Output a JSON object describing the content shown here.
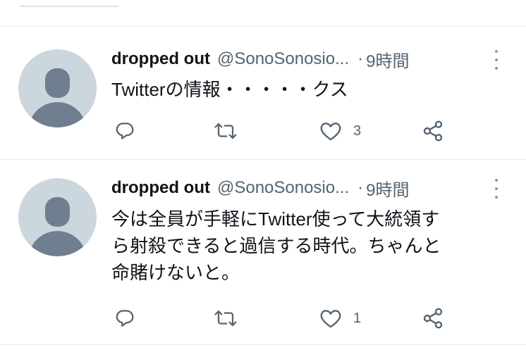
{
  "tweets": [
    {
      "name": "dropped out",
      "handle": "@SonoSonosio...",
      "separator": "·",
      "time": "9時間",
      "text": "Twitterの情報・・・・・クス",
      "like_count": "3"
    },
    {
      "name": "dropped out",
      "handle": "@SonoSonosio...",
      "separator": "·",
      "time": "9時間",
      "text_lines": [
        "今は全員が手軽にTwitter使って大統領す",
        "ら射殺できると過信する時代。ちゃんと",
        "命賭けないと。"
      ],
      "like_count": "1"
    }
  ],
  "icons": {
    "reply": "reply-icon",
    "retweet": "retweet-icon",
    "like": "heart-icon",
    "share": "share-icon",
    "more": "more-icon"
  },
  "colors": {
    "text": "#0f1419",
    "secondary": "#536471",
    "avatar_bg": "#ccd6dd",
    "avatar_fg": "#6f7f90",
    "divider": "#e6e9ec"
  }
}
